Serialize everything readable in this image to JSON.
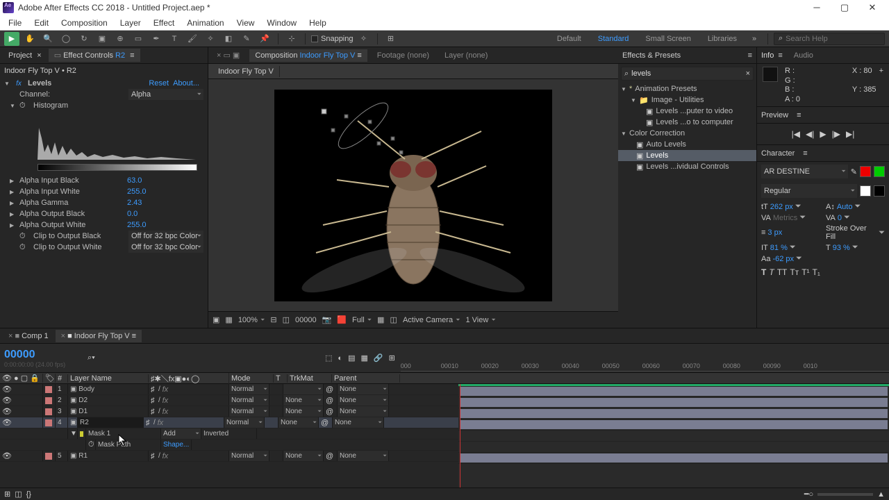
{
  "titlebar": {
    "title": "Adobe After Effects CC 2018 - Untitled Project.aep *"
  },
  "menu": [
    "File",
    "Edit",
    "Composition",
    "Layer",
    "Effect",
    "Animation",
    "View",
    "Window",
    "Help"
  ],
  "toolbar": {
    "snapping": "Snapping",
    "ws": [
      "Default",
      "Standard",
      "Small Screen",
      "Libraries"
    ],
    "search_ph": "Search Help"
  },
  "left": {
    "tabs": {
      "project": "Project",
      "effect_controls": "Effect Controls",
      "effect_target": "R2"
    },
    "source": "Indoor Fly Top V • R2",
    "effect": {
      "name": "Levels",
      "reset": "Reset",
      "about": "About...",
      "channel_label": "Channel:",
      "channel_value": "Alpha",
      "histogram": "Histogram",
      "params": [
        {
          "n": "Alpha Input Black",
          "v": "63.0"
        },
        {
          "n": "Alpha Input White",
          "v": "255.0"
        },
        {
          "n": "Alpha Gamma",
          "v": "2.43"
        },
        {
          "n": "Alpha Output Black",
          "v": "0.0"
        },
        {
          "n": "Alpha Output White",
          "v": "255.0"
        }
      ],
      "clip_black": "Clip to Output Black",
      "clip_white": "Clip to Output White",
      "clip_val": "Off for 32 bpc Color"
    }
  },
  "center": {
    "tabs": {
      "composition": "Composition",
      "active": "Indoor Fly Top V",
      "footage": "Footage  (none)",
      "layer": "Layer  (none)"
    },
    "viewer_tab": "Indoor Fly Top V",
    "footer": {
      "zoom": "100%",
      "time": "00000",
      "res": "Full",
      "camera": "Active Camera",
      "views": "1 View"
    }
  },
  "right": {
    "panel": "Effects & Presets",
    "search": "levels",
    "tree": {
      "presets": "Animation Presets",
      "utilities": "Image - Utilities",
      "u_items": [
        "Levels ...puter to video",
        "Levels ...o to computer"
      ],
      "cc": "Color Correction",
      "cc_items": [
        "Auto Levels",
        "Levels",
        "Levels ...ividual Controls"
      ]
    }
  },
  "farright": {
    "info": {
      "label": "Info",
      "audio": "Audio",
      "r": "R :",
      "g": "G :",
      "b": "B :",
      "a": "A : 0",
      "x": "X : 80",
      "y": "Y : 385"
    },
    "preview": "Preview",
    "character": {
      "label": "Character",
      "font": "AR DESTINE",
      "style": "Regular",
      "size": "262 px",
      "leading": "Auto",
      "metrics": "Metrics",
      "tracking": "0",
      "stroke": "3 px",
      "fillmode": "Stroke Over Fill",
      "vscale": "81 %",
      "hscale": "93 %",
      "baseline": "-62 px"
    }
  },
  "timeline": {
    "tabs": {
      "comp1": "Comp 1",
      "active": "Indoor Fly Top V"
    },
    "timecode": "00000",
    "fps": "0:00:00:00 (24.00 fps)",
    "col": {
      "num": "#",
      "name": "Layer Name",
      "mode": "Mode",
      "t": "T",
      "trkmat": "TrkMat",
      "parent": "Parent"
    },
    "layers": [
      {
        "i": "1",
        "name": "Body",
        "mode": "Normal",
        "parent": "None",
        "trk": ""
      },
      {
        "i": "2",
        "name": "D2",
        "mode": "Normal",
        "parent": "None",
        "trk": "None"
      },
      {
        "i": "3",
        "name": "D1",
        "mode": "Normal",
        "parent": "None",
        "trk": "None"
      },
      {
        "i": "4",
        "name": "R2",
        "mode": "Normal",
        "parent": "None",
        "trk": "None"
      },
      {
        "i": "5",
        "name": "R1",
        "mode": "Normal",
        "parent": "None",
        "trk": "None"
      }
    ],
    "mask": {
      "name": "Mask 1",
      "mode": "Add",
      "inverted": "Inverted",
      "path_label": "Mask Path",
      "path_val": "Shape..."
    },
    "ruler": [
      "000",
      "00010",
      "00020",
      "00030",
      "00040",
      "00050",
      "00060",
      "00070",
      "00080",
      "00090",
      "0010"
    ]
  }
}
